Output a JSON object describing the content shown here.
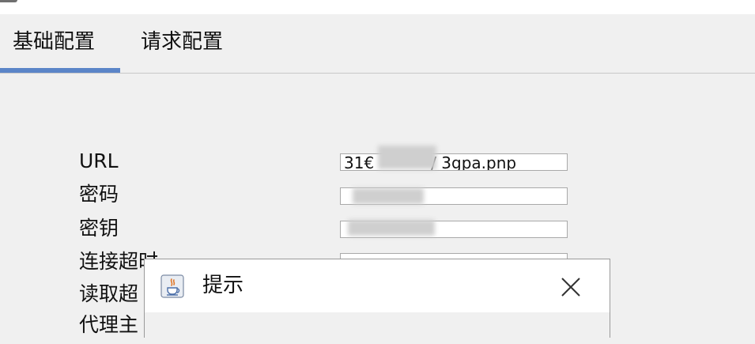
{
  "tabs": [
    {
      "label": "基础配置",
      "selected": true
    },
    {
      "label": "请求配置",
      "selected": false
    }
  ],
  "accent_color": "#5b85c8",
  "form": {
    "labels": [
      "URL",
      "密码",
      "密钥",
      "连接超时",
      "读取超",
      "代理主"
    ],
    "url_value": "31€",
    "url_value_tail": "/ 3gpa.pnp"
  },
  "dialog": {
    "title": "提示",
    "icon": "java-cup-icon",
    "close_icon": "close-icon"
  }
}
